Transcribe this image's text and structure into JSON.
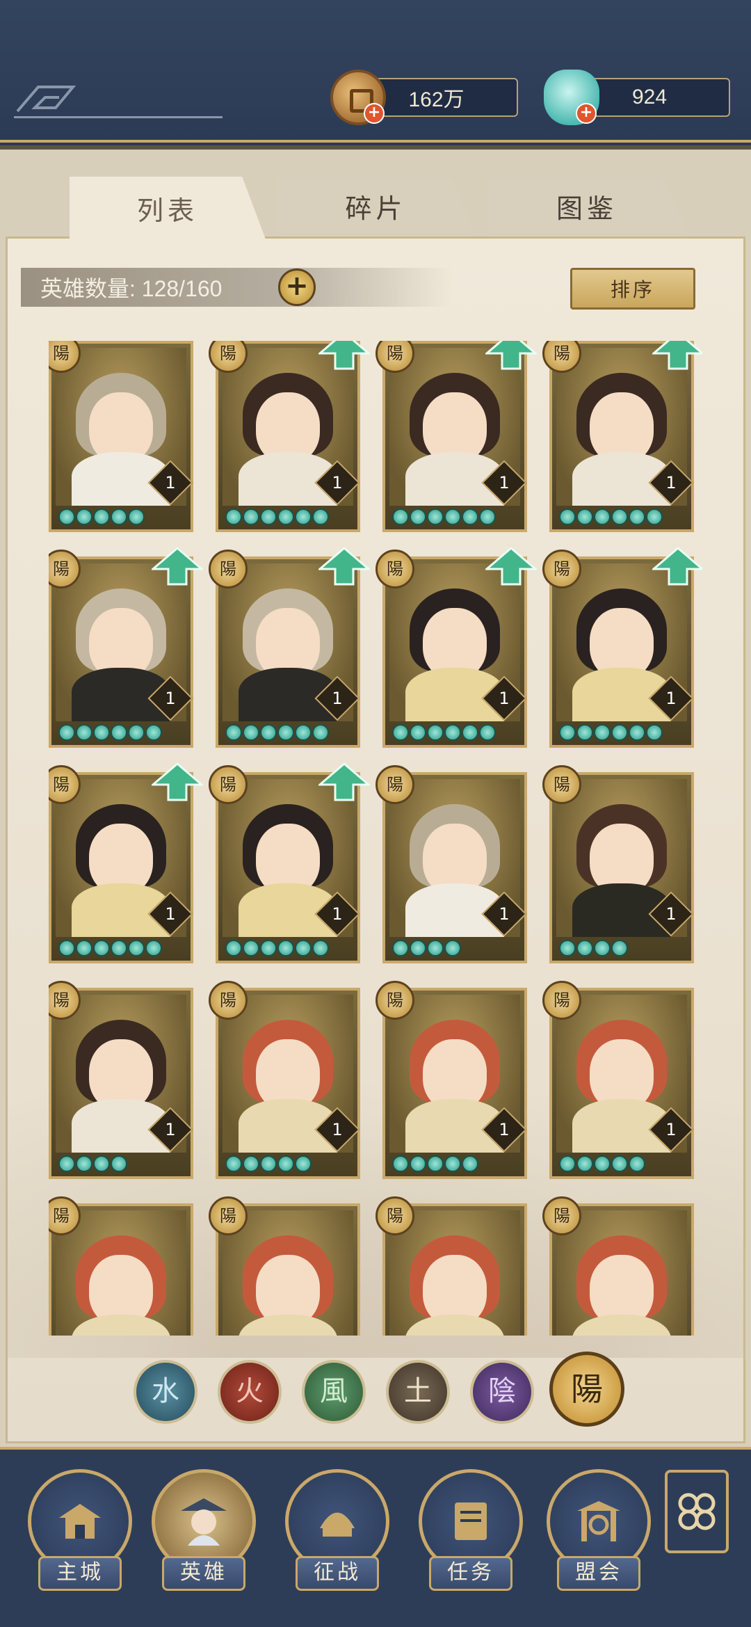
{
  "currencies": {
    "coins": "162万",
    "gems": "924"
  },
  "tabs": [
    {
      "label": "列表"
    },
    {
      "label": "碎片"
    },
    {
      "label": "图鉴"
    }
  ],
  "hero_count": "英雄数量: 128/160",
  "sort_label": "排序",
  "card_badge": "陽",
  "heroes": [
    {
      "level": "1",
      "stars": 5,
      "upgrade": false,
      "hair": "#b8ad94",
      "robe": "#f0ebe0"
    },
    {
      "level": "1",
      "stars": 6,
      "upgrade": true,
      "hair": "#3a2a22",
      "robe": "#ece5d6"
    },
    {
      "level": "1",
      "stars": 6,
      "upgrade": true,
      "hair": "#3a2a22",
      "robe": "#ece5d6"
    },
    {
      "level": "1",
      "stars": 6,
      "upgrade": true,
      "hair": "#3a2a22",
      "robe": "#ece5d6"
    },
    {
      "level": "1",
      "stars": 6,
      "upgrade": true,
      "hair": "#c4b8a2",
      "robe": "#2b2a26"
    },
    {
      "level": "1",
      "stars": 6,
      "upgrade": true,
      "hair": "#c4b8a2",
      "robe": "#2b2a26"
    },
    {
      "level": "1",
      "stars": 6,
      "upgrade": true,
      "hair": "#2a2220",
      "robe": "#e8d69a"
    },
    {
      "level": "1",
      "stars": 6,
      "upgrade": true,
      "hair": "#2a2220",
      "robe": "#e8d69a"
    },
    {
      "level": "1",
      "stars": 6,
      "upgrade": true,
      "hair": "#2a2220",
      "robe": "#e8d69a"
    },
    {
      "level": "1",
      "stars": 6,
      "upgrade": true,
      "hair": "#2a2220",
      "robe": "#e8d69a"
    },
    {
      "level": "1",
      "stars": 4,
      "upgrade": false,
      "hair": "#b8ad94",
      "robe": "#f0ebe0"
    },
    {
      "level": "1",
      "stars": 4,
      "upgrade": false,
      "hair": "#4a3326",
      "robe": "#2a2a22"
    },
    {
      "level": "1",
      "stars": 4,
      "upgrade": false,
      "hair": "#3a2a22",
      "robe": "#ece5d6"
    },
    {
      "level": "1",
      "stars": 5,
      "upgrade": false,
      "hair": "#c45a3c",
      "robe": "#e8d9b0"
    },
    {
      "level": "1",
      "stars": 5,
      "upgrade": false,
      "hair": "#c45a3c",
      "robe": "#e8d9b0"
    },
    {
      "level": "1",
      "stars": 5,
      "upgrade": false,
      "hair": "#c45a3c",
      "robe": "#e8d9b0"
    },
    {
      "level": "",
      "stars": 0,
      "upgrade": false,
      "hair": "#c45a3c",
      "robe": "#e8d9b0"
    },
    {
      "level": "",
      "stars": 0,
      "upgrade": false,
      "hair": "#c45a3c",
      "robe": "#e8d9b0"
    },
    {
      "level": "",
      "stars": 0,
      "upgrade": false,
      "hair": "#c45a3c",
      "robe": "#e8d9b0"
    },
    {
      "level": "",
      "stars": 0,
      "upgrade": false,
      "hair": "#c45a3c",
      "robe": "#e8d9b0"
    }
  ],
  "elements": [
    {
      "glyph": "水",
      "name": "water"
    },
    {
      "glyph": "火",
      "name": "fire"
    },
    {
      "glyph": "風",
      "name": "wind"
    },
    {
      "glyph": "土",
      "name": "earth"
    },
    {
      "glyph": "陰",
      "name": "yin"
    },
    {
      "glyph": "陽",
      "name": "yang"
    }
  ],
  "nav": [
    {
      "label": "主城"
    },
    {
      "label": "英雄"
    },
    {
      "label": "征战"
    },
    {
      "label": "任务"
    },
    {
      "label": "盟会"
    }
  ]
}
